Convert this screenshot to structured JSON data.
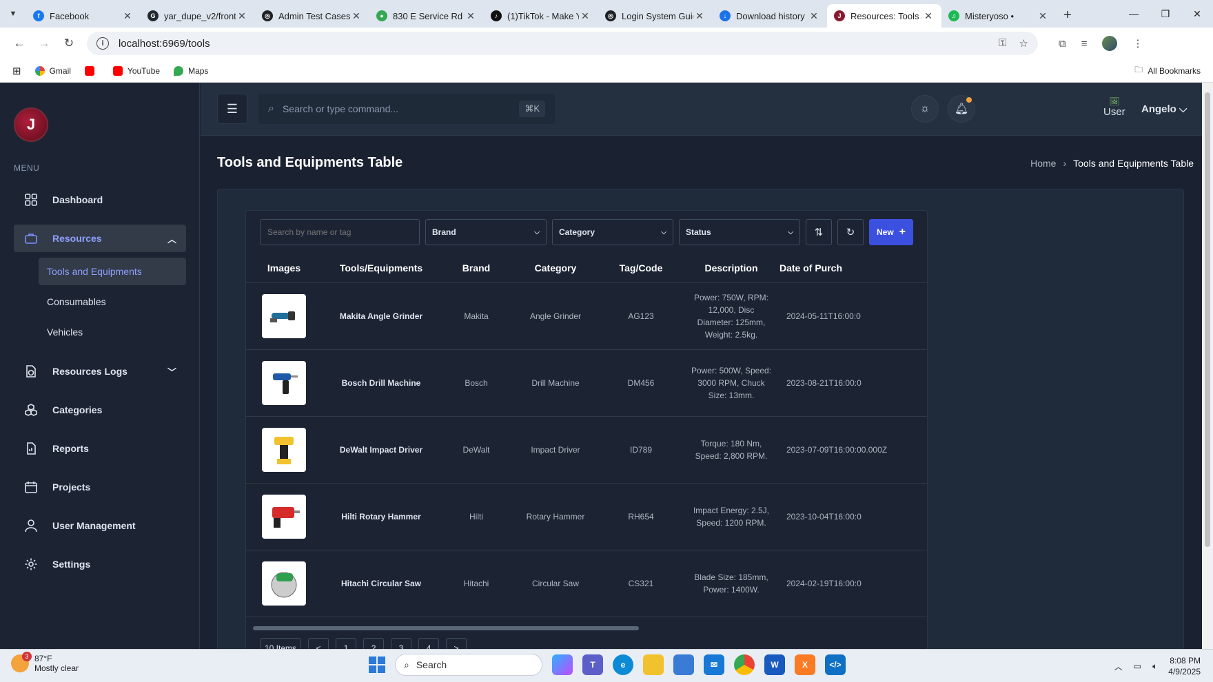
{
  "browser": {
    "tabs": [
      {
        "title": "Facebook",
        "color": "#1877f2",
        "glyph": "f"
      },
      {
        "title": "yar_dupe_v2/front",
        "color": "#24292f",
        "glyph": "G"
      },
      {
        "title": "Admin Test Cases",
        "color": "#202124",
        "glyph": "◎"
      },
      {
        "title": "830 E Service Rd -",
        "color": "#34a853",
        "glyph": "●"
      },
      {
        "title": "(1)TikTok - Make Y",
        "color": "#111111",
        "glyph": "♪"
      },
      {
        "title": "Login System Guid",
        "color": "#202124",
        "glyph": "◎"
      },
      {
        "title": "Download history",
        "color": "#1a73e8",
        "glyph": "↓"
      },
      {
        "title": "Resources: Tools a",
        "color": "#8b1a2e",
        "glyph": "J"
      },
      {
        "title": "Misteryoso • ",
        "color": "#1db954",
        "glyph": "♫"
      }
    ],
    "url": "localhost:6969/tools",
    "bookmarks": [
      "Gmail",
      "YouTube",
      "Maps"
    ],
    "all_bookmarks": "All Bookmarks"
  },
  "sidebar": {
    "menu_label": "MENU",
    "items": {
      "dashboard": "Dashboard",
      "resources": "Resources",
      "tools": "Tools and Equipments",
      "consumables": "Consumables",
      "vehicles": "Vehicles",
      "logs": "Resources Logs",
      "categories": "Categories",
      "reports": "Reports",
      "projects": "Projects",
      "users": "User Management",
      "settings": "Settings"
    }
  },
  "header": {
    "search_placeholder": "Search or type command...",
    "shortcut": "⌘K",
    "user_img_alt": "User",
    "user_name": "Angelo"
  },
  "page": {
    "title": "Tools and Equipments Table",
    "breadcrumb_home": "Home",
    "breadcrumb_current": "Tools and Equipments Table"
  },
  "filters": {
    "search_placeholder": "Search by name or tag",
    "brand": "Brand",
    "category": "Category",
    "status": "Status",
    "new_label": "New"
  },
  "table": {
    "columns": [
      "Images",
      "Tools/Equipments",
      "Brand",
      "Category",
      "Tag/Code",
      "Description",
      "Date of Purch"
    ],
    "rows": [
      {
        "name": "Makita Angle Grinder",
        "brand": "Makita",
        "category": "Angle Grinder",
        "tag": "AG123",
        "desc": "Power: 750W, RPM: 12,000, Disc Diameter: 125mm, Weight: 2.5kg.",
        "date": "2024-05-11T16:00:0"
      },
      {
        "name": "Bosch Drill Machine",
        "brand": "Bosch",
        "category": "Drill Machine",
        "tag": "DM456",
        "desc": "Power: 500W, Speed: 3000 RPM, Chuck Size: 13mm.",
        "date": "2023-08-21T16:00:0"
      },
      {
        "name": "DeWalt Impact Driver",
        "brand": "DeWalt",
        "category": "Impact Driver",
        "tag": "ID789",
        "desc": "Torque: 180 Nm, Speed: 2,800 RPM.",
        "date": "2023-07-09T16:00:00.000Z"
      },
      {
        "name": "Hilti Rotary Hammer",
        "brand": "Hilti",
        "category": "Rotary Hammer",
        "tag": "RH654",
        "desc": "Impact Energy: 2.5J, Speed: 1200 RPM.",
        "date": "2023-10-04T16:00:0"
      },
      {
        "name": "Hitachi Circular Saw",
        "brand": "Hitachi",
        "category": "Circular Saw",
        "tag": "CS321",
        "desc": "Blade Size: 185mm, Power: 1400W.",
        "date": "2024-02-19T16:00:0"
      }
    ]
  },
  "pagination": {
    "items_label": "10 Items",
    "prev": "<",
    "pages": [
      "1",
      "2",
      "3",
      "4"
    ],
    "next": ">"
  },
  "taskbar": {
    "temp": "87°F",
    "weather": "Mostly clear",
    "weather_badge": "3",
    "search": "Search",
    "time": "8:08 PM",
    "date": "4/9/2025"
  }
}
